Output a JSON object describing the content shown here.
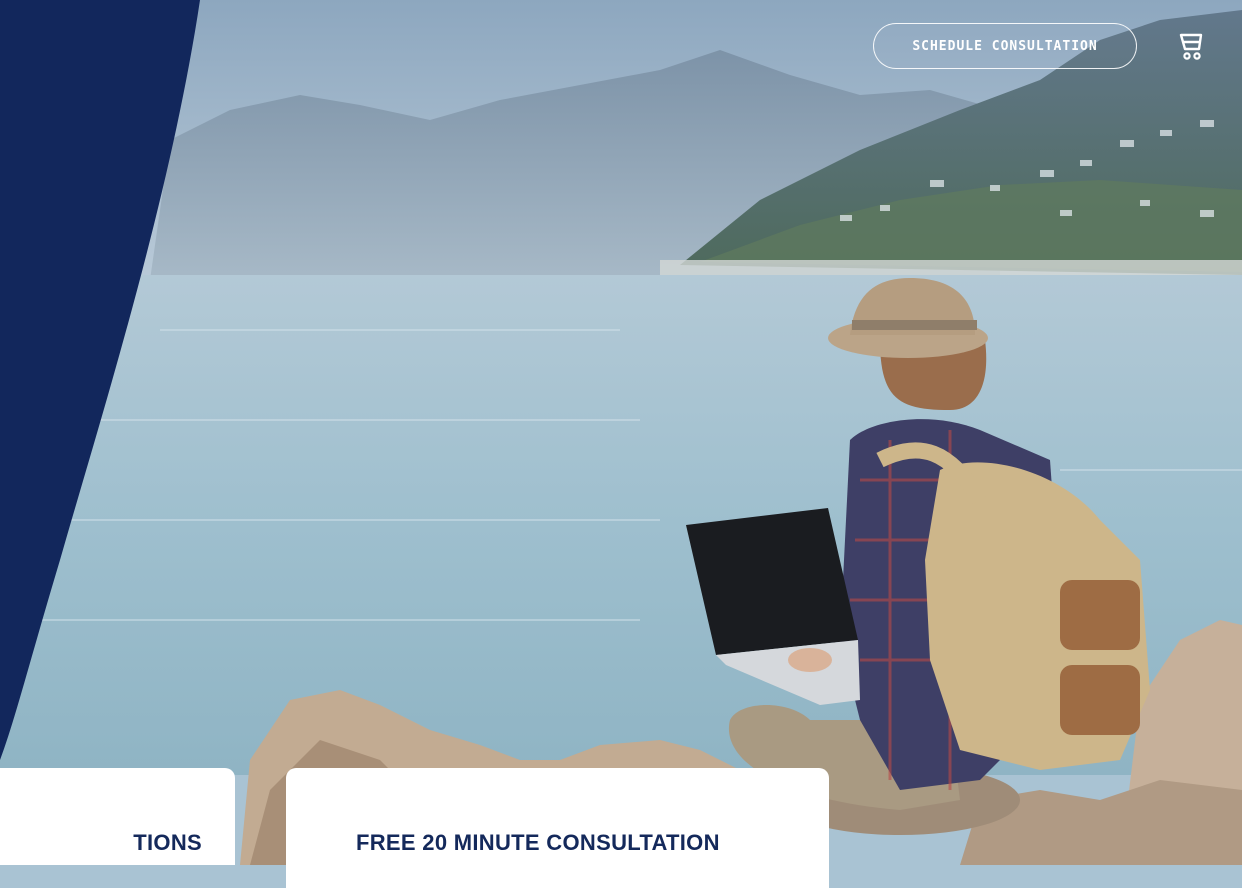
{
  "header": {
    "schedule_button_label": "SCHEDULE CONSULTATION",
    "cart_icon": "cart-icon"
  },
  "cards": [
    {
      "title": "TIONS"
    },
    {
      "title": "FREE 20 MINUTE CONSULTATION"
    }
  ],
  "colors": {
    "navy_panel": "#12275c",
    "card_title": "#14295b",
    "card_bg": "#ffffff"
  }
}
